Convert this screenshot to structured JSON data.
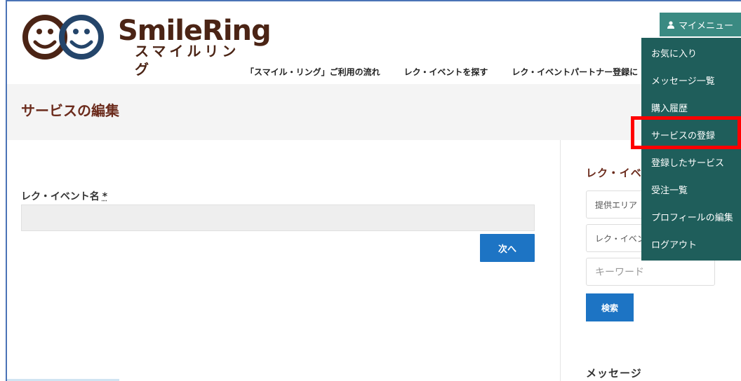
{
  "logo": {
    "name_en": "SmileRing",
    "name_jp": "スマイルリング"
  },
  "nav": [
    "「スマイル・リング」ご利用の流れ",
    "レク・イベントを探す",
    "レク・イベントパートナー登録に"
  ],
  "page_title": "サービスの編集",
  "form": {
    "event_name_label": "レク・イベント名",
    "required_mark": "*",
    "event_name_value": "",
    "next_button": "次へ"
  },
  "sidebar": {
    "heading": "レク・イベ",
    "area_field": "提供エリア",
    "event_field": "レク・イベン",
    "keyword_placeholder": "キーワード",
    "search_button": "検索",
    "message_heading": "メッセージ"
  },
  "mymenu": {
    "button_label": "マイメニュー",
    "icon": "user-icon",
    "items": [
      "お気に入り",
      "メッセージ一覧",
      "購入履歴",
      "サービスの登録",
      "登録したサービス",
      "受注一覧",
      "プロフィールの編集",
      "ログアウト"
    ],
    "highlighted_item": "サービスの登録"
  },
  "colors": {
    "brand_brown": "#4b2415",
    "title_brown": "#6b2b1c",
    "primary_blue": "#1d74c4",
    "menu_bg": "#1f5e5b",
    "menu_button": "#3a8a82",
    "highlight_red": "#ff0000"
  }
}
